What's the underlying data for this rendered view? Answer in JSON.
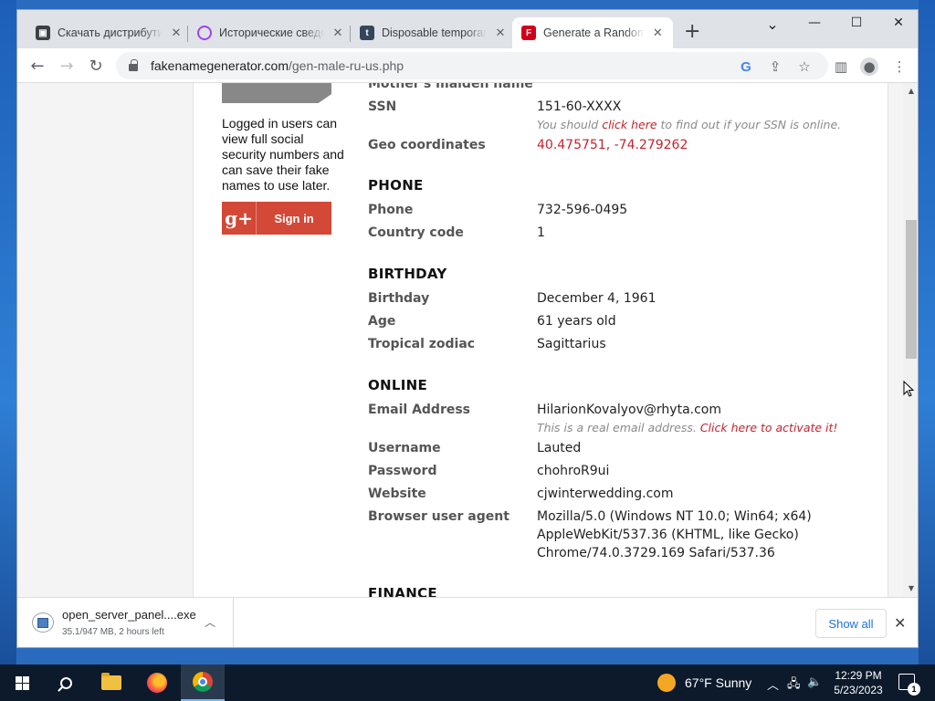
{
  "tabs": [
    {
      "title": "Скачать дистрибутив",
      "close": "✕",
      "icon": "terminal-icon",
      "color": "#3c4043"
    },
    {
      "title": "Исторические сведения",
      "close": "✕",
      "icon": "podcast-icon",
      "color": "#a142f4"
    },
    {
      "title": "Disposable temporary",
      "close": "✕",
      "icon": "tumblr-t-icon",
      "color": "#35465c"
    },
    {
      "title": "Generate a Random Name",
      "close": "✕",
      "icon": "fakename-f-icon",
      "color": "#d0021b",
      "active": true
    }
  ],
  "new_tab": "+",
  "window_controls": {
    "dropdown": "⌄",
    "minimize": "—",
    "maximize": "☐",
    "close": "✕"
  },
  "address": {
    "domain": "fakenamegenerator.com",
    "path": "/gen-male-ru-us.php"
  },
  "sidebar": {
    "login_note": "Logged in users can view full social security numbers and can save their fake names to use later.",
    "gplus_glyph": "g+",
    "signin_label": "Sign in"
  },
  "identity": {
    "mothers_maiden_label": "Mother's maiden name",
    "ssn_label": "SSN",
    "ssn_value": "151-60-XXXX",
    "ssn_note_pre": "You should ",
    "ssn_note_link": "click here",
    "ssn_note_post": " to find out if your SSN is online.",
    "geo_label": "Geo coordinates",
    "geo_value": "40.475751, -74.279262"
  },
  "phone": {
    "heading": "PHONE",
    "phone_label": "Phone",
    "phone_value": "732-596-0495",
    "country_label": "Country code",
    "country_value": "1"
  },
  "birthday": {
    "heading": "BIRTHDAY",
    "birthday_label": "Birthday",
    "birthday_value": "December 4, 1961",
    "age_label": "Age",
    "age_value": "61 years old",
    "zodiac_label": "Tropical zodiac",
    "zodiac_value": "Sagittarius"
  },
  "online": {
    "heading": "ONLINE",
    "email_label": "Email Address",
    "email_value": "HilarionKovalyov@rhyta.com",
    "email_note_pre": "This is a real email address. ",
    "email_note_link": "Click here to activate it!",
    "username_label": "Username",
    "username_value": "Lauted",
    "password_label": "Password",
    "password_value": "chohroR9ui",
    "website_label": "Website",
    "website_value": "cjwinterwedding.com",
    "ua_label": "Browser user agent",
    "ua_lines": [
      "Mozilla/5.0 (Windows NT 10.0; Win64; x64)",
      "AppleWebKit/537.36 (KHTML, like Gecko)",
      "Chrome/74.0.3729.169 Safari/537.36"
    ]
  },
  "finance": {
    "heading": "FINANCE"
  },
  "downloads": {
    "filename": "open_server_panel....exe",
    "meta": "35.1/947 MB, 2 hours left",
    "show_all": "Show all",
    "close": "✕"
  },
  "taskbar": {
    "weather": "67°F  Sunny",
    "time": "12:29 PM",
    "date": "5/23/2023",
    "notifications": "1"
  },
  "colors": {
    "accent_red": "#c3242f",
    "gplus_red": "#d34836",
    "link_blue": "#1a73e8"
  }
}
